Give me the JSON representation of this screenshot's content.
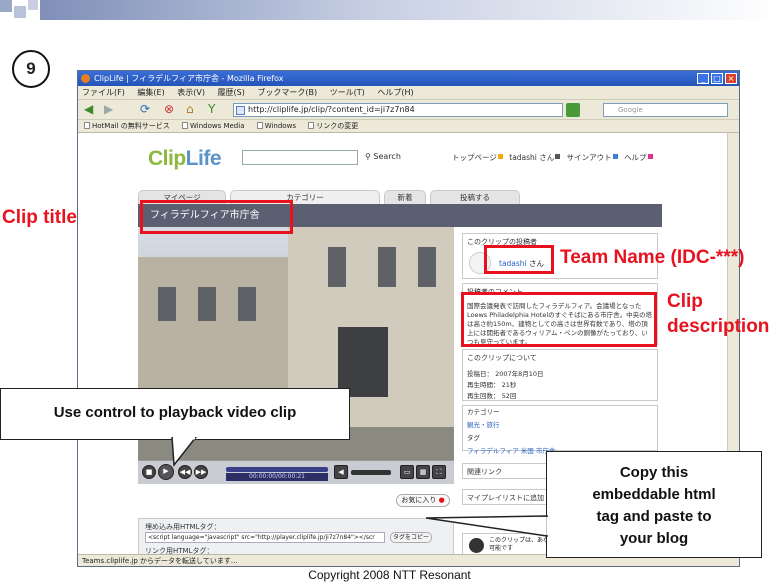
{
  "slide": {
    "step_number": "9",
    "copyright": "Copyright 2008 NTT Resonant"
  },
  "browser": {
    "title": "ClipLife | フィラデルフィア市庁舎 - Mozilla Firefox",
    "menu": [
      "ファイル(F)",
      "編集(E)",
      "表示(V)",
      "履歴(S)",
      "ブックマーク(B)",
      "ツール(T)",
      "ヘルプ(H)"
    ],
    "url": "http://cliplife.jp/clip/?content_id=ji7z7n84",
    "search_placeholder": "Google",
    "bookmarks": [
      "HotMail の無料サービス",
      "Windows Media",
      "Windows",
      "リンクの変更"
    ],
    "status": "Teams.cliplife.jp からデータを転送しています..."
  },
  "site": {
    "logo_clip": "Clip",
    "logo_life": "Life",
    "search_label": "Search",
    "top_links": [
      "トップページ",
      "tadashi さん",
      "サインアウト",
      "ヘルプ"
    ],
    "tabs": [
      "マイページ",
      "カテゴリー",
      "新着",
      "投稿する"
    ],
    "clip_title": "フィラデルフィア市庁舎",
    "video_time": "00:00:00/00:00:21",
    "poster_heading": "このクリップの投稿者",
    "poster_name": "tadashi",
    "poster_suffix": "さん",
    "comment_heading": "投稿者のコメント",
    "comment_text": "国際会議発表で訪問したフィラデルフィア。会議場となったLoews Philadelphia Hotelのすぐそばにある市庁舎。中央の塔は高さ約150m、建物としての高さは世界有数であり、塔の頂上には開拓者であるウィリアム・ペンの銅像がたっており、いつも見守っています。",
    "about_heading": "このクリップについて",
    "about_rows": [
      {
        "label": "投稿日：",
        "value": "2007年8月10日"
      },
      {
        "label": "再生時間：",
        "value": "21秒"
      },
      {
        "label": "再生回数：",
        "value": "52回"
      }
    ],
    "category_label": "カテゴリー",
    "category_value": "観光・旅行",
    "tag_label": "タグ",
    "tag_value": "フィラデルフィア 米国 市庁舎",
    "related_label": "関連リンク",
    "playlist_label": "マイプレイリストに追加",
    "fav_button": "お気に入り",
    "embed_label": "埋め込み用HTMLタグ：",
    "embed_code": "<script language=\"javascript\" src=\"http://player.cliplife.jp/ji7z7n84\"></scr",
    "copy_button": "タグをコピー",
    "link_label": "リンク用HTMLタグ：",
    "bottom_note": "このクリップは、あなたのブログや下記サイトに貼り付け可能です"
  },
  "annotations": {
    "clip_title": "Clip title",
    "team_name": "Team Name (IDC-***)",
    "clip_desc_line1": "Clip",
    "clip_desc_line2": "description",
    "playback": "Use control to playback video clip",
    "copy_line1": "Copy this",
    "copy_line2": "embeddable html",
    "copy_line3": "tag and paste to",
    "copy_line4": "your blog"
  },
  "colors": {
    "annotation_red": "#e8121f",
    "titlebar_blue": "#2454b8",
    "title_strip": "#5a5f72",
    "logo_green": "#8db73d"
  }
}
